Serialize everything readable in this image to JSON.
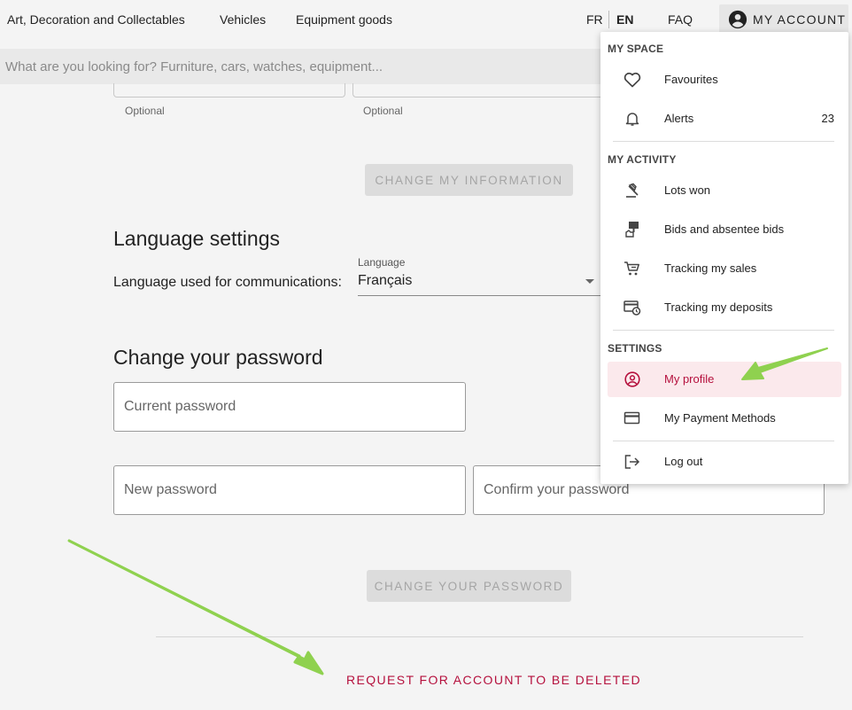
{
  "nav": {
    "links": [
      "Art, Decoration and Collectables",
      "Vehicles",
      "Equipment goods"
    ],
    "lang_fr": "FR",
    "lang_en": "EN",
    "faq": "FAQ",
    "account_label": "MY ACCOUNT"
  },
  "search": {
    "placeholder": "What are you looking for? Furniture, cars, watches, equipment..."
  },
  "form": {
    "optional_1": "Optional",
    "optional_2": "Optional",
    "change_info_button": "CHANGE MY INFORMATION",
    "language_title": "Language settings",
    "language_label": "Language used for communications:",
    "language_field_label": "Language",
    "language_value": "Français",
    "password_title": "Change your password",
    "current_password_placeholder": "Current password",
    "new_password_placeholder": "New password",
    "confirm_password_placeholder": "Confirm your password",
    "change_password_button": "CHANGE YOUR PASSWORD",
    "delete_account_link": "REQUEST FOR ACCOUNT TO BE DELETED"
  },
  "menu": {
    "my_space": "MY SPACE",
    "favourites": "Favourites",
    "alerts": "Alerts",
    "alerts_count": "23",
    "my_activity": "MY ACTIVITY",
    "lots_won": "Lots won",
    "bids": "Bids and absentee bids",
    "tracking_sales": "Tracking my sales",
    "tracking_deposits": "Tracking my deposits",
    "settings": "SETTINGS",
    "my_profile": "My profile",
    "payment_methods": "My Payment Methods",
    "log_out": "Log out"
  },
  "colors": {
    "accent": "#b5103d",
    "active_bg": "#fbe9ec",
    "annotation_arrow": "#8fd14f"
  }
}
